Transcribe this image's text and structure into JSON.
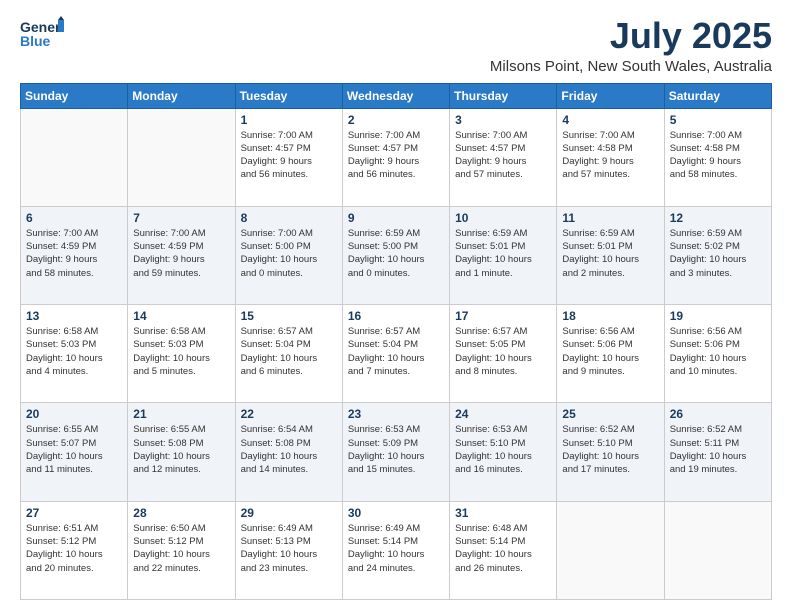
{
  "header": {
    "logo_general": "General",
    "logo_blue": "Blue",
    "month_year": "July 2025",
    "location": "Milsons Point, New South Wales, Australia"
  },
  "days_of_week": [
    "Sunday",
    "Monday",
    "Tuesday",
    "Wednesday",
    "Thursday",
    "Friday",
    "Saturday"
  ],
  "weeks": [
    [
      {
        "num": "",
        "info": ""
      },
      {
        "num": "",
        "info": ""
      },
      {
        "num": "1",
        "info": "Sunrise: 7:00 AM\nSunset: 4:57 PM\nDaylight: 9 hours\nand 56 minutes."
      },
      {
        "num": "2",
        "info": "Sunrise: 7:00 AM\nSunset: 4:57 PM\nDaylight: 9 hours\nand 56 minutes."
      },
      {
        "num": "3",
        "info": "Sunrise: 7:00 AM\nSunset: 4:57 PM\nDaylight: 9 hours\nand 57 minutes."
      },
      {
        "num": "4",
        "info": "Sunrise: 7:00 AM\nSunset: 4:58 PM\nDaylight: 9 hours\nand 57 minutes."
      },
      {
        "num": "5",
        "info": "Sunrise: 7:00 AM\nSunset: 4:58 PM\nDaylight: 9 hours\nand 58 minutes."
      }
    ],
    [
      {
        "num": "6",
        "info": "Sunrise: 7:00 AM\nSunset: 4:59 PM\nDaylight: 9 hours\nand 58 minutes."
      },
      {
        "num": "7",
        "info": "Sunrise: 7:00 AM\nSunset: 4:59 PM\nDaylight: 9 hours\nand 59 minutes."
      },
      {
        "num": "8",
        "info": "Sunrise: 7:00 AM\nSunset: 5:00 PM\nDaylight: 10 hours\nand 0 minutes."
      },
      {
        "num": "9",
        "info": "Sunrise: 6:59 AM\nSunset: 5:00 PM\nDaylight: 10 hours\nand 0 minutes."
      },
      {
        "num": "10",
        "info": "Sunrise: 6:59 AM\nSunset: 5:01 PM\nDaylight: 10 hours\nand 1 minute."
      },
      {
        "num": "11",
        "info": "Sunrise: 6:59 AM\nSunset: 5:01 PM\nDaylight: 10 hours\nand 2 minutes."
      },
      {
        "num": "12",
        "info": "Sunrise: 6:59 AM\nSunset: 5:02 PM\nDaylight: 10 hours\nand 3 minutes."
      }
    ],
    [
      {
        "num": "13",
        "info": "Sunrise: 6:58 AM\nSunset: 5:03 PM\nDaylight: 10 hours\nand 4 minutes."
      },
      {
        "num": "14",
        "info": "Sunrise: 6:58 AM\nSunset: 5:03 PM\nDaylight: 10 hours\nand 5 minutes."
      },
      {
        "num": "15",
        "info": "Sunrise: 6:57 AM\nSunset: 5:04 PM\nDaylight: 10 hours\nand 6 minutes."
      },
      {
        "num": "16",
        "info": "Sunrise: 6:57 AM\nSunset: 5:04 PM\nDaylight: 10 hours\nand 7 minutes."
      },
      {
        "num": "17",
        "info": "Sunrise: 6:57 AM\nSunset: 5:05 PM\nDaylight: 10 hours\nand 8 minutes."
      },
      {
        "num": "18",
        "info": "Sunrise: 6:56 AM\nSunset: 5:06 PM\nDaylight: 10 hours\nand 9 minutes."
      },
      {
        "num": "19",
        "info": "Sunrise: 6:56 AM\nSunset: 5:06 PM\nDaylight: 10 hours\nand 10 minutes."
      }
    ],
    [
      {
        "num": "20",
        "info": "Sunrise: 6:55 AM\nSunset: 5:07 PM\nDaylight: 10 hours\nand 11 minutes."
      },
      {
        "num": "21",
        "info": "Sunrise: 6:55 AM\nSunset: 5:08 PM\nDaylight: 10 hours\nand 12 minutes."
      },
      {
        "num": "22",
        "info": "Sunrise: 6:54 AM\nSunset: 5:08 PM\nDaylight: 10 hours\nand 14 minutes."
      },
      {
        "num": "23",
        "info": "Sunrise: 6:53 AM\nSunset: 5:09 PM\nDaylight: 10 hours\nand 15 minutes."
      },
      {
        "num": "24",
        "info": "Sunrise: 6:53 AM\nSunset: 5:10 PM\nDaylight: 10 hours\nand 16 minutes."
      },
      {
        "num": "25",
        "info": "Sunrise: 6:52 AM\nSunset: 5:10 PM\nDaylight: 10 hours\nand 17 minutes."
      },
      {
        "num": "26",
        "info": "Sunrise: 6:52 AM\nSunset: 5:11 PM\nDaylight: 10 hours\nand 19 minutes."
      }
    ],
    [
      {
        "num": "27",
        "info": "Sunrise: 6:51 AM\nSunset: 5:12 PM\nDaylight: 10 hours\nand 20 minutes."
      },
      {
        "num": "28",
        "info": "Sunrise: 6:50 AM\nSunset: 5:12 PM\nDaylight: 10 hours\nand 22 minutes."
      },
      {
        "num": "29",
        "info": "Sunrise: 6:49 AM\nSunset: 5:13 PM\nDaylight: 10 hours\nand 23 minutes."
      },
      {
        "num": "30",
        "info": "Sunrise: 6:49 AM\nSunset: 5:14 PM\nDaylight: 10 hours\nand 24 minutes."
      },
      {
        "num": "31",
        "info": "Sunrise: 6:48 AM\nSunset: 5:14 PM\nDaylight: 10 hours\nand 26 minutes."
      },
      {
        "num": "",
        "info": ""
      },
      {
        "num": "",
        "info": ""
      }
    ]
  ]
}
